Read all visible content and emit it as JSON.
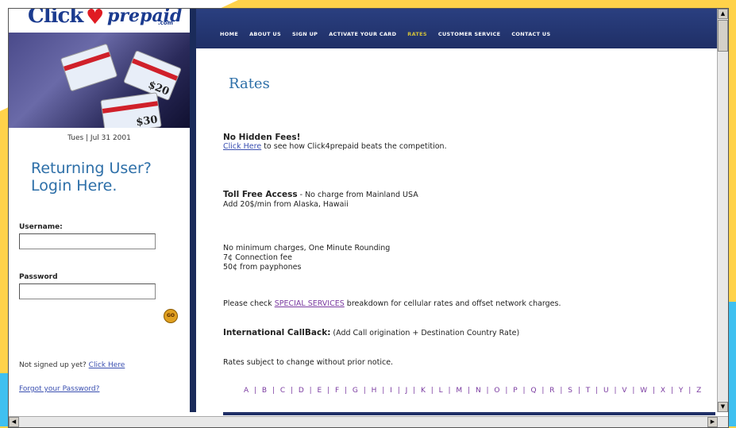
{
  "logo": {
    "click": "Click",
    "heart": "♥",
    "prepaid": "prepaid",
    "dotcom": ".com"
  },
  "banner": {
    "card1": "$20",
    "card2": "$30"
  },
  "sidebar": {
    "date": "Tues | Jul 31 2001",
    "returning_line1": "Returning User?",
    "returning_line2": "Login Here.",
    "username_label": "Username:",
    "username_value": "",
    "password_label": "Password",
    "password_value": "",
    "go_label": "GO",
    "not_signed": "Not signed up yet?",
    "click_here": "Click Here",
    "forgot": "Forgot your Password?"
  },
  "nav": {
    "items": [
      "HOME",
      "ABOUT US",
      "SIGN UP",
      "ACTIVATE YOUR CARD",
      "RATES",
      "CUSTOMER SERVICE",
      "CONTACT US"
    ],
    "active": "RATES"
  },
  "main": {
    "title": "Rates",
    "no_hidden_fees": "No Hidden Fees!",
    "click_here": "Click Here",
    "beats_competition": " to see how Click4prepaid beats the competition.",
    "toll_free": "Toll Free Access",
    "toll_free_rest": " - No charge from Mainland USA",
    "add_alaska": "Add 20$/min from Alaska, Hawaii",
    "no_minimum": "No minimum charges, One Minute Rounding",
    "connection_fee": "7¢ Connection fee",
    "payphones": "50¢ from payphones",
    "please_check": "Please check ",
    "special_services": "SPECIAL SERVICES",
    "breakdown": " breakdown for cellular rates and offset network charges.",
    "intl_callback": "International CallBack:",
    "intl_callback_rest": " (Add Call origination + Destination Country Rate)",
    "rates_subject": "Rates subject to change without prior notice.",
    "alphabet": "A | B | C | D | E | F | G | H | I | J | K | L | M | N | O | P | Q | R | S | T | U | V | W | X | Y | Z"
  },
  "colors": {
    "navbar": "#1f2f66",
    "accent_gold": "#d4c23a",
    "link_purple": "#7a3aa0",
    "heading_blue": "#2d6fa8",
    "background_yellow": "#ffd24a"
  }
}
